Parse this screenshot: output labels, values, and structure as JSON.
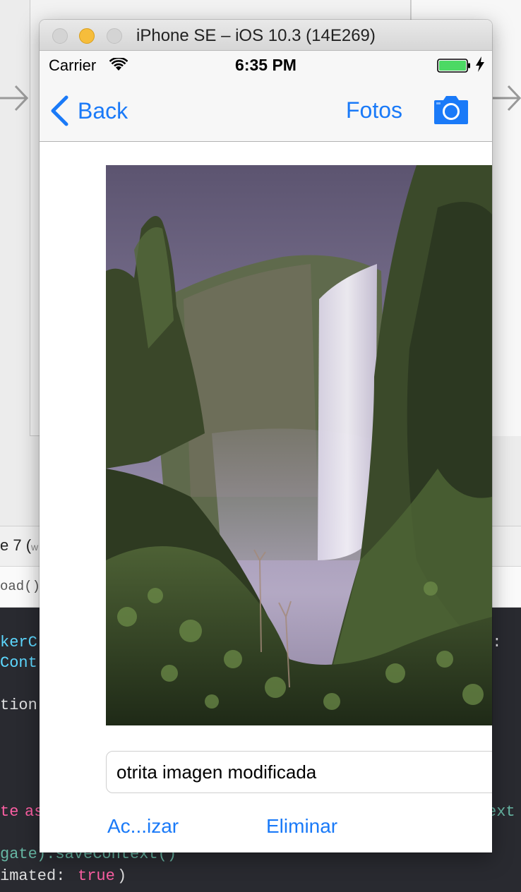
{
  "simulator": {
    "window_title": "iPhone SE – iOS 10.3 (14E269)"
  },
  "status_bar": {
    "carrier": "Carrier",
    "time": "6:35 PM",
    "battery_color": "#4cd964"
  },
  "nav_bar": {
    "back_label": "Back",
    "fotos_label": "Fotos",
    "camera_icon": "camera-icon",
    "tint_color": "#1a7af8"
  },
  "content": {
    "photo_subject": "waterfall-photo",
    "caption_value": "otrita imagen modificada",
    "update_label": "Ac...izar",
    "delete_label": "Eliminar"
  },
  "background": {
    "device_text": "e 7 (",
    "device_text_faded": "w",
    "jump_text": "oad()",
    "code_lines": {
      "l1a": "kerC",
      "l1b": "o:",
      "l2": "Cont",
      "l3": "tion:",
      "l4a": "te ",
      "l4b": "as",
      "l4c": "ext",
      "l5a": "gate",
      "l5b": ").saveContext()",
      "l6a": "imated: ",
      "l6b": "true",
      "l6c": ")"
    }
  }
}
